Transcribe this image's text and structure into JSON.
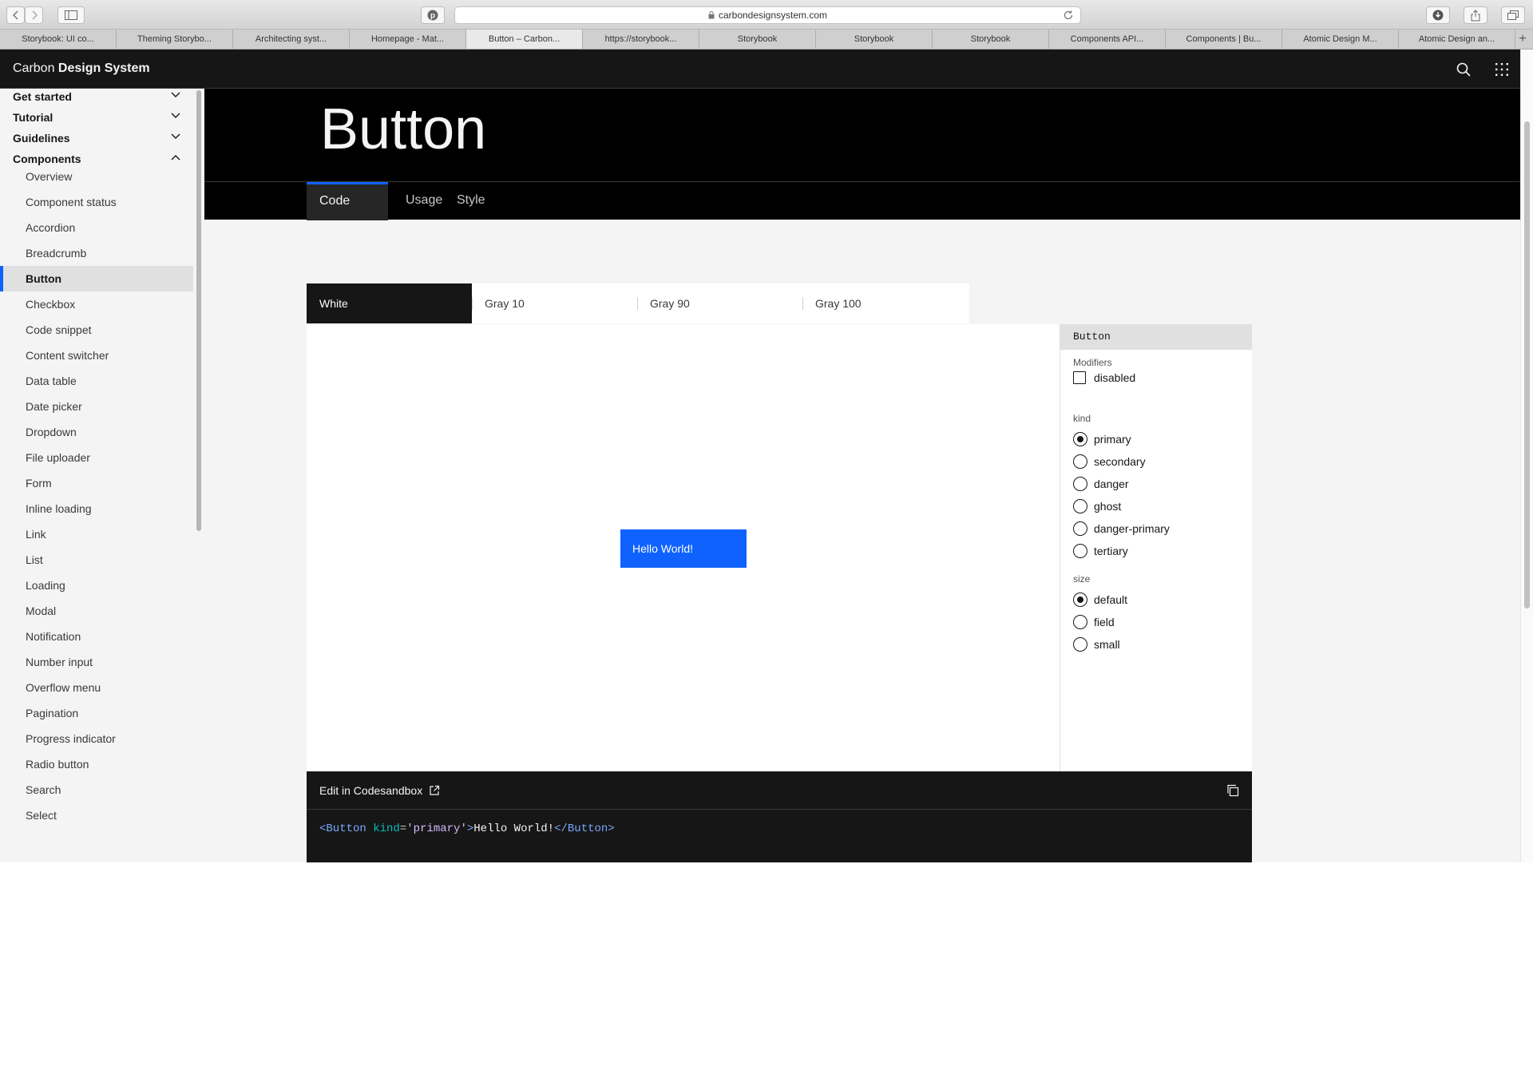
{
  "browser": {
    "url": "carbondesignsystem.com",
    "tabs": [
      {
        "label": "Storybook: UI co...",
        "active": false
      },
      {
        "label": "Theming Storybo...",
        "active": false
      },
      {
        "label": "Architecting syst...",
        "active": false
      },
      {
        "label": "Homepage - Mat...",
        "active": false
      },
      {
        "label": "Button – Carbon...",
        "active": true
      },
      {
        "label": "https://storybook...",
        "active": false
      },
      {
        "label": "Storybook",
        "active": false
      },
      {
        "label": "Storybook",
        "active": false
      },
      {
        "label": "Storybook",
        "active": false
      },
      {
        "label": "Components API...",
        "active": false
      },
      {
        "label": "Components | Bu...",
        "active": false
      },
      {
        "label": "Atomic Design M...",
        "active": false
      },
      {
        "label": "Atomic Design an...",
        "active": false
      }
    ],
    "new_tab": "+"
  },
  "site": {
    "brand_light": "Carbon ",
    "brand_bold": "Design System",
    "accent": "#0f62fe"
  },
  "sidebar": {
    "sections": [
      {
        "label": "Get started",
        "expanded": false
      },
      {
        "label": "Tutorial",
        "expanded": false
      },
      {
        "label": "Guidelines",
        "expanded": false
      },
      {
        "label": "Components",
        "expanded": true
      }
    ],
    "items": [
      {
        "label": "Overview"
      },
      {
        "label": "Component status"
      },
      {
        "label": "Accordion"
      },
      {
        "label": "Breadcrumb"
      },
      {
        "label": "Button",
        "active": true
      },
      {
        "label": "Checkbox"
      },
      {
        "label": "Code snippet"
      },
      {
        "label": "Content switcher"
      },
      {
        "label": "Data table"
      },
      {
        "label": "Date picker"
      },
      {
        "label": "Dropdown"
      },
      {
        "label": "File uploader"
      },
      {
        "label": "Form"
      },
      {
        "label": "Inline loading"
      },
      {
        "label": "Link"
      },
      {
        "label": "List"
      },
      {
        "label": "Loading"
      },
      {
        "label": "Modal"
      },
      {
        "label": "Notification"
      },
      {
        "label": "Number input"
      },
      {
        "label": "Overflow menu"
      },
      {
        "label": "Pagination"
      },
      {
        "label": "Progress indicator"
      },
      {
        "label": "Radio button"
      },
      {
        "label": "Search"
      },
      {
        "label": "Select"
      }
    ]
  },
  "page": {
    "title": "Button",
    "tabs": [
      {
        "label": "Code",
        "active": true
      },
      {
        "label": "Usage",
        "active": false
      },
      {
        "label": "Style",
        "active": false
      }
    ]
  },
  "themes": [
    {
      "label": "White",
      "active": true
    },
    {
      "label": "Gray 10",
      "active": false
    },
    {
      "label": "Gray 90",
      "active": false
    },
    {
      "label": "Gray 100",
      "active": false
    }
  ],
  "preview": {
    "button_label": "Hello World!"
  },
  "knobs": {
    "title": "Button",
    "modifiers_label": "Modifiers",
    "disabled_label": "disabled",
    "disabled_checked": false,
    "kind_label": "kind",
    "kinds": [
      {
        "label": "primary",
        "selected": true
      },
      {
        "label": "secondary",
        "selected": false
      },
      {
        "label": "danger",
        "selected": false
      },
      {
        "label": "ghost",
        "selected": false
      },
      {
        "label": "danger-primary",
        "selected": false
      },
      {
        "label": "tertiary",
        "selected": false
      }
    ],
    "size_label": "size",
    "sizes": [
      {
        "label": "default",
        "selected": true
      },
      {
        "label": "field",
        "selected": false
      },
      {
        "label": "small",
        "selected": false
      }
    ]
  },
  "code": {
    "edit_link": "Edit in Codesandbox",
    "tokens": [
      {
        "text": "<Button ",
        "type": "tag"
      },
      {
        "text": "kind",
        "type": "attr"
      },
      {
        "text": "=",
        "type": "punct"
      },
      {
        "text": "'primary'",
        "type": "str"
      },
      {
        "text": ">",
        "type": "tag"
      },
      {
        "text": "Hello World!",
        "type": "text"
      },
      {
        "text": "</Button>",
        "type": "tag"
      }
    ]
  }
}
